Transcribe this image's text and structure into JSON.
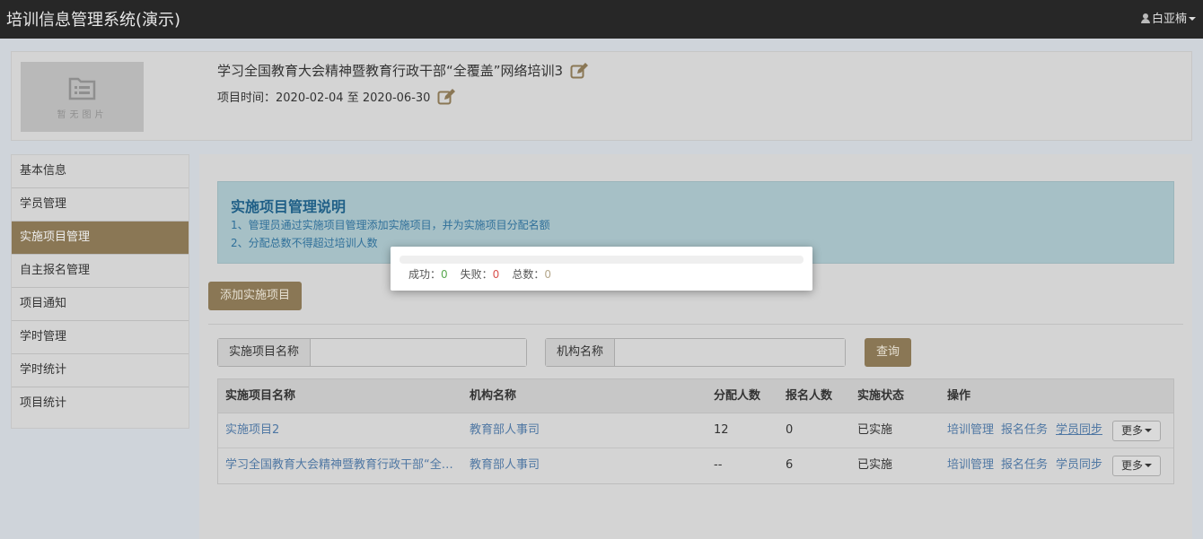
{
  "app": {
    "title": "培训信息管理系统(演示)",
    "user": "白亚楠"
  },
  "project": {
    "no_image": "暂无图片",
    "title": "学习全国教育大会精神暨教育行政干部“全覆盖”网络培训3",
    "time_label": "项目时间：",
    "start": "2020-02-04",
    "sep": "至",
    "end": "2020-06-30"
  },
  "sidebar": {
    "items": [
      {
        "label": "基本信息"
      },
      {
        "label": "学员管理"
      },
      {
        "label": "实施项目管理"
      },
      {
        "label": "自主报名管理"
      },
      {
        "label": "项目通知"
      },
      {
        "label": "学时管理"
      },
      {
        "label": "学时统计"
      },
      {
        "label": "项目统计"
      }
    ],
    "active_index": 2
  },
  "notice": {
    "title": "实施项目管理说明",
    "lines": [
      "1、管理员通过实施项目管理添加实施项目，并为实施项目分配名额",
      "2、分配总数不得超过培训人数"
    ]
  },
  "actions": {
    "add_label": "添加实施项目",
    "query_label": "查询"
  },
  "filters": {
    "name_label": "实施项目名称",
    "org_label": "机构名称",
    "name_value": "",
    "org_value": ""
  },
  "table": {
    "headers": [
      "实施项目名称",
      "机构名称",
      "分配人数",
      "报名人数",
      "实施状态",
      "操作"
    ],
    "rows": [
      {
        "name": "实施项目2",
        "org": "教育部人事司",
        "allocated": "12",
        "enrolled": "0",
        "status": "已实施"
      },
      {
        "name": "学习全国教育大会精神暨教育行政干部“全…",
        "org": "教育部人事司",
        "allocated": "--",
        "enrolled": "6",
        "status": "已实施"
      }
    ],
    "ops": {
      "train": "培训管理",
      "task": "报名任务",
      "sync": "学员同步",
      "more": "更多"
    }
  },
  "progress_dialog": {
    "progress": 0,
    "success_label": "成功：",
    "success": "0",
    "fail_label": "失败：",
    "fail": "0",
    "total_label": "总数：",
    "total": "0"
  },
  "colors": {
    "accent": "#8a7755",
    "link": "#4f77a3",
    "success": "#5aa850",
    "fail": "#d9534f"
  }
}
